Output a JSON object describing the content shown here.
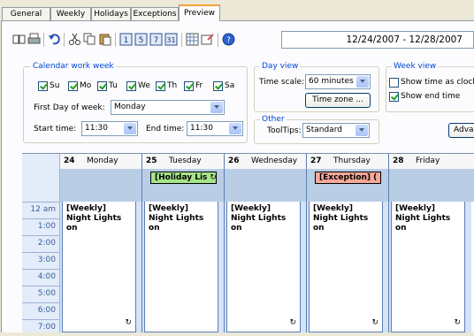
{
  "tabs": [
    {
      "label": "General"
    },
    {
      "label": "Weekly"
    },
    {
      "label": "Holidays"
    },
    {
      "label": "Exceptions"
    },
    {
      "label": "Preview",
      "active": true
    }
  ],
  "toolbar": {
    "date_range": "12/24/2007 - 12/28/2007",
    "icons": [
      "open-book-icon",
      "print-icon",
      "undo-icon",
      "cut-icon",
      "copy-icon",
      "paste-icon",
      "day-view-icon",
      "work-week-view-icon",
      "week-view-icon",
      "month-view-icon",
      "grid-icon",
      "properties-icon",
      "help-icon"
    ]
  },
  "calendar_work_week": {
    "legend": "Calendar work week",
    "days": [
      {
        "label": "Su",
        "checked": true
      },
      {
        "label": "Mo",
        "checked": true
      },
      {
        "label": "Tu",
        "checked": true
      },
      {
        "label": "We",
        "checked": true
      },
      {
        "label": "Th",
        "checked": true
      },
      {
        "label": "Fr",
        "checked": true
      },
      {
        "label": "Sa",
        "checked": true
      }
    ],
    "first_day_label": "First Day of week:",
    "first_day_value": "Monday",
    "start_time_label": "Start time:",
    "start_time_value": "11:30",
    "end_time_label": "End time:",
    "end_time_value": "11:30"
  },
  "day_view": {
    "legend": "Day view",
    "time_scale_label": "Time scale:",
    "time_scale_value": "60 minutes",
    "time_zone_button": "Time zone ..."
  },
  "other": {
    "legend": "Other",
    "tooltips_label": "ToolTips:",
    "tooltips_value": "Standard"
  },
  "week_view": {
    "legend": "Week view",
    "show_time_as_clocks": "Show time as clocks",
    "show_time_as_clocks_checked": false,
    "show_end_time": "Show end time",
    "show_end_time_checked": true,
    "advanced_button": "Advan"
  },
  "calendar": {
    "days": [
      {
        "num": "24",
        "name": "Monday",
        "badge": null,
        "appt": "[Weekly] Night Lights on"
      },
      {
        "num": "25",
        "name": "Tuesday",
        "badge": "[Holiday Lis",
        "badge_color": "#a6e58a",
        "appt": "[Weekly] Night Lights on"
      },
      {
        "num": "26",
        "name": "Wednesday",
        "badge": null,
        "appt": "[Weekly] Night Lights on"
      },
      {
        "num": "27",
        "name": "Thursday",
        "badge": "[Exception] (",
        "badge_color": "#f8a898",
        "appt": "[Weekly] Night Lights on"
      },
      {
        "num": "28",
        "name": "Friday",
        "badge": null,
        "appt": "[Weekly] Night Lights on"
      }
    ],
    "times": [
      "12 am",
      "1:00",
      "2:00",
      "3:00",
      "4:00",
      "5:00",
      "6:00",
      "7:00"
    ]
  }
}
